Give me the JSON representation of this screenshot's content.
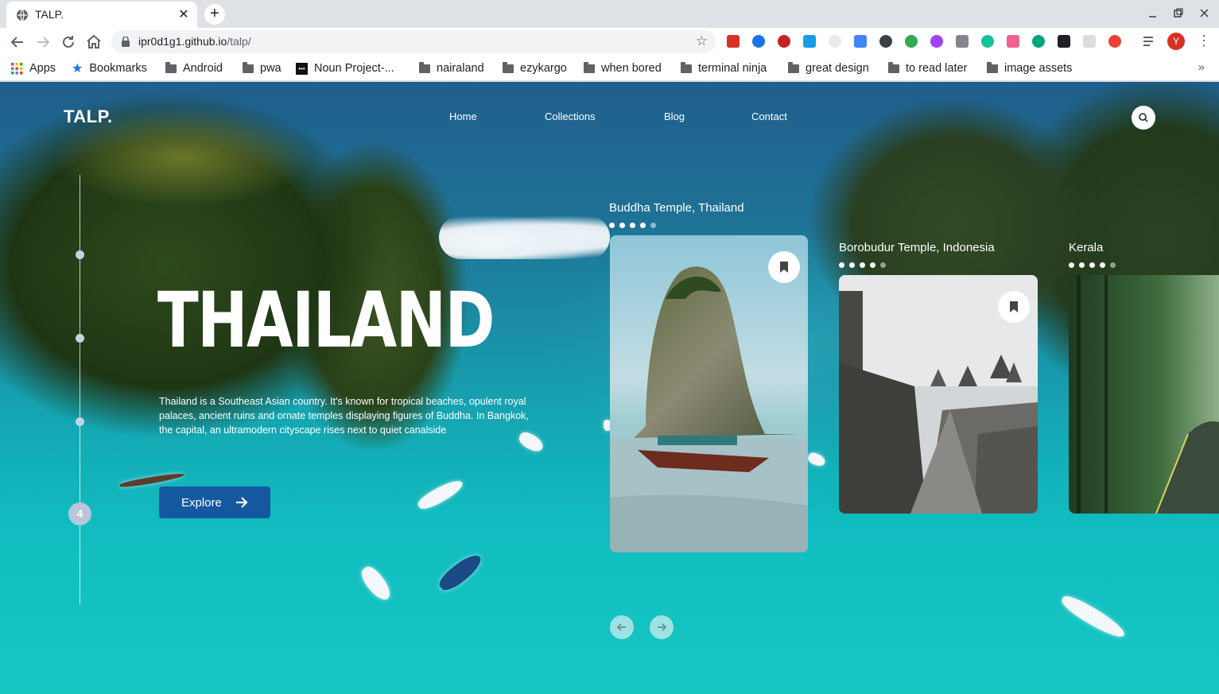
{
  "browser": {
    "tab_title": "TALP.",
    "close_glyph": "✕",
    "new_tab_glyph": "+",
    "url_host": "ipr0d1g1.github.io",
    "url_path": "/talp/",
    "avatar_letter": "Y",
    "bookmarks": [
      {
        "label": "Apps",
        "icon": "apps-grid-icon"
      },
      {
        "label": "Bookmarks",
        "icon": "star-icon"
      },
      {
        "label": "Android",
        "icon": "folder-icon"
      },
      {
        "label": "pwa",
        "icon": "folder-icon"
      },
      {
        "label": "Noun Project-...",
        "icon": "noun-project-icon"
      },
      {
        "label": "nairaland",
        "icon": "folder-icon"
      },
      {
        "label": "ezykargo",
        "icon": "folder-icon"
      },
      {
        "label": "when bored",
        "icon": "folder-icon"
      },
      {
        "label": "terminal ninja",
        "icon": "folder-icon"
      },
      {
        "label": "great design",
        "icon": "folder-icon"
      },
      {
        "label": "to read later",
        "icon": "folder-icon"
      },
      {
        "label": "image assets",
        "icon": "folder-icon"
      }
    ],
    "bookmarks_overflow": "»"
  },
  "site": {
    "logo": "TALP.",
    "nav": [
      "Home",
      "Collections",
      "Blog",
      "Contact"
    ],
    "timeline_current": "4",
    "hero": {
      "title": "THAILAND",
      "description": "Thailand is a Southeast Asian country. It's known for tropical beaches, opulent royal palaces, ancient ruins and ornate temples displaying figures of Buddha. In Bangkok, the capital, an ultramodern cityscape rises next to quiet canalside",
      "cta": "Explore"
    },
    "cards": [
      {
        "label": "Buddha Temple, Thailand"
      },
      {
        "label": "Borobudur Temple, Indonesia"
      },
      {
        "label": "Kerala"
      }
    ]
  },
  "colors": {
    "accent_button": "#1458a0",
    "sea": "#10bcbf"
  }
}
